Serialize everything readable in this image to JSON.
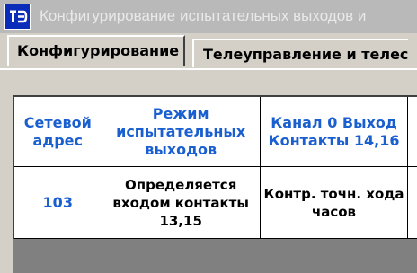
{
  "window": {
    "title": "Конфигурирование испытательных выходов и",
    "icon": "app-logo-icon"
  },
  "tabs": [
    {
      "label": "Конфигурирование",
      "active": true
    },
    {
      "label": "Телеуправление и телес",
      "active": false
    }
  ],
  "table": {
    "columns": [
      "Сетевой адрес",
      "Режим испытательных выходов",
      "Канал 0 Выход Контакты 14,16"
    ],
    "rows": [
      {
        "address": "103",
        "mode": "Определяется входом контакты 13,15",
        "channel0": "Контр. точн. хода часов"
      }
    ]
  },
  "colors": {
    "header_text": "#1a5fd0",
    "title_bar": "#b9b9b9",
    "icon_bg": "#0a2cb8"
  }
}
